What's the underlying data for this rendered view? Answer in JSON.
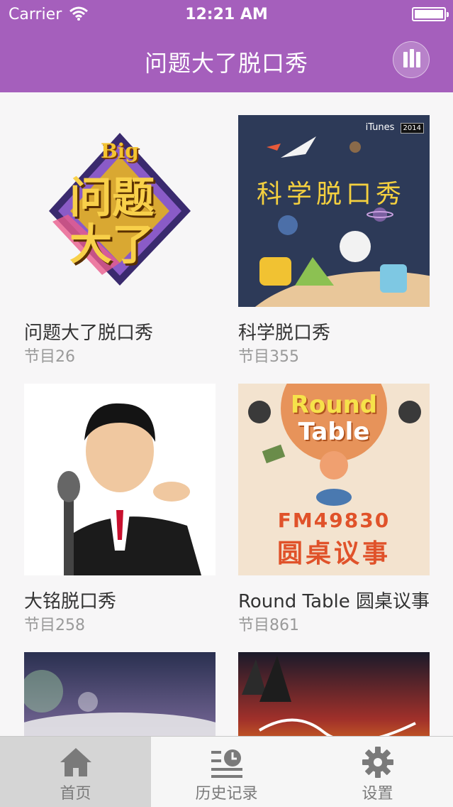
{
  "status_bar": {
    "carrier": "Carrier",
    "time": "12:21 AM"
  },
  "header": {
    "title": "问题大了脱口秀",
    "now_playing_icon": "equalizer-icon"
  },
  "colors": {
    "header": "#a55fbc",
    "tab_active": "#d5d5d5"
  },
  "shows": [
    {
      "title": "问题大了脱口秀",
      "count": "节目26",
      "logo_small": "Big",
      "logo_text": "问题大了"
    },
    {
      "title": "科学脱口秀",
      "count": "节目355",
      "badge": "iTunes",
      "badge_year": "2014",
      "cover_text": "科学脱口秀"
    },
    {
      "title": "大铭脱口秀",
      "count": "节目258"
    },
    {
      "title": "Round Table 圆桌议事",
      "count": "节目861",
      "cover_line1": "Round",
      "cover_line2": "Table",
      "cover_code": "FM49830",
      "cover_cn": "圆桌议事"
    },
    {
      "title": "",
      "count": ""
    },
    {
      "title": "",
      "count": ""
    }
  ],
  "tabs": [
    {
      "label": "首页",
      "icon": "home-icon",
      "active": true
    },
    {
      "label": "历史记录",
      "icon": "history-icon",
      "active": false
    },
    {
      "label": "设置",
      "icon": "gear-icon",
      "active": false
    }
  ]
}
